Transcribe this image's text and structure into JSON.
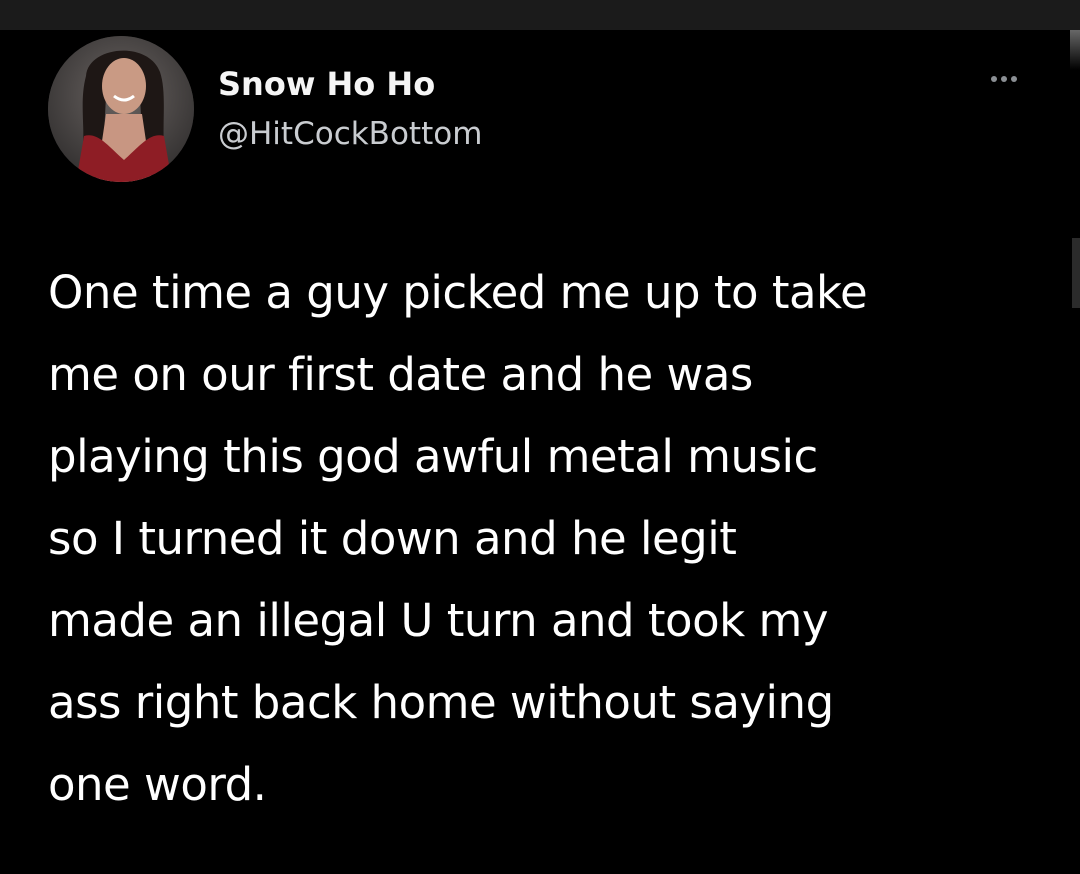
{
  "tweet": {
    "author": {
      "display_name": "Snow Ho Ho",
      "handle": "@HitCockBottom"
    },
    "more_icon": "more-horizontal-icon",
    "text_lines": [
      "One time a guy picked me up to take",
      "me on our first date and he was",
      "playing this god awful metal music",
      "so I turned it down and he legit",
      "made an illegal U turn and took my",
      "ass right back home without saying",
      "one word."
    ]
  },
  "colors": {
    "background": "#000000",
    "text_primary": "#ffffff",
    "text_secondary": "#c9ccd0",
    "icon_muted": "#8b8f94"
  }
}
